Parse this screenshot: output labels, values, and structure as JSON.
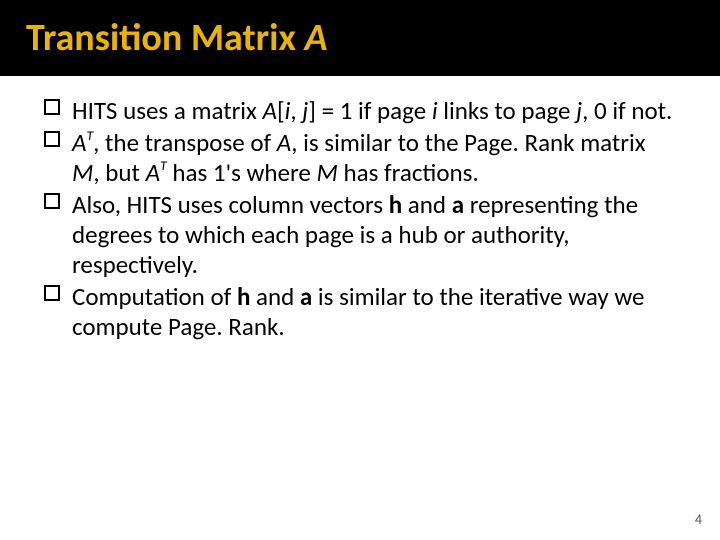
{
  "title": {
    "pre": "Transition Matrix ",
    "ital": "A"
  },
  "bullets": {
    "b1": {
      "t0": "HITS uses a matrix ",
      "t1": "A",
      "t2": "[",
      "t3": "i",
      "t4": ", ",
      "t5": "j",
      "t6": "] = 1 if page ",
      "t7": "i",
      "t8": " links to page ",
      "t9": "j",
      "t10": ", 0 if not."
    },
    "b2": {
      "t0": "A",
      "t1": "T",
      "t2": ", the transpose of ",
      "t3": "A",
      "t4": ", is similar to the Page. Rank matrix ",
      "t5": "M",
      "t6": ", but ",
      "t7": "A",
      "t8": "T",
      "t9": " has 1's where ",
      "t10": "M",
      "t11": " has fractions."
    },
    "b3": {
      "t0": "Also, HITS uses column vectors ",
      "t1": "h",
      "t2": " and ",
      "t3": "a",
      "t4": " representing the degrees to which each page is a hub or authority, respectively."
    },
    "b4": {
      "t0": "Computation of ",
      "t1": "h",
      "t2": " and ",
      "t3": "a",
      "t4": " is similar to the iterative way we compute Page. Rank."
    }
  },
  "page_number": "4"
}
